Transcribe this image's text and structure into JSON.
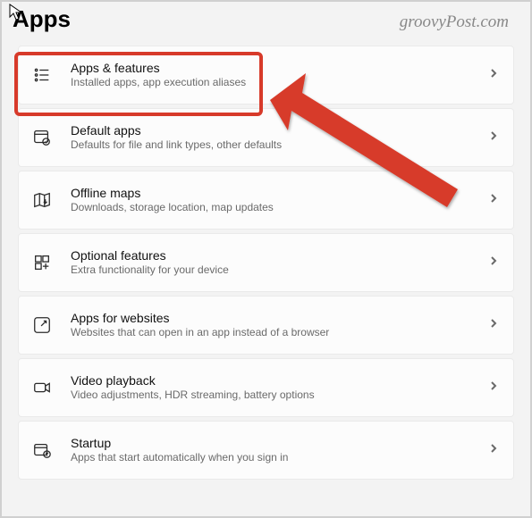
{
  "header": {
    "title": "Apps",
    "watermark": "groovyPost.com"
  },
  "items": [
    {
      "icon": "apps-features-icon",
      "title": "Apps & features",
      "subtitle": "Installed apps, app execution aliases"
    },
    {
      "icon": "default-apps-icon",
      "title": "Default apps",
      "subtitle": "Defaults for file and link types, other defaults"
    },
    {
      "icon": "offline-maps-icon",
      "title": "Offline maps",
      "subtitle": "Downloads, storage location, map updates"
    },
    {
      "icon": "optional-features-icon",
      "title": "Optional features",
      "subtitle": "Extra functionality for your device"
    },
    {
      "icon": "apps-for-websites-icon",
      "title": "Apps for websites",
      "subtitle": "Websites that can open in an app instead of a browser"
    },
    {
      "icon": "video-playback-icon",
      "title": "Video playback",
      "subtitle": "Video adjustments, HDR streaming, battery options"
    },
    {
      "icon": "startup-icon",
      "title": "Startup",
      "subtitle": "Apps that start automatically when you sign in"
    }
  ],
  "annotation": {
    "highlight_color": "#d73a2a"
  }
}
